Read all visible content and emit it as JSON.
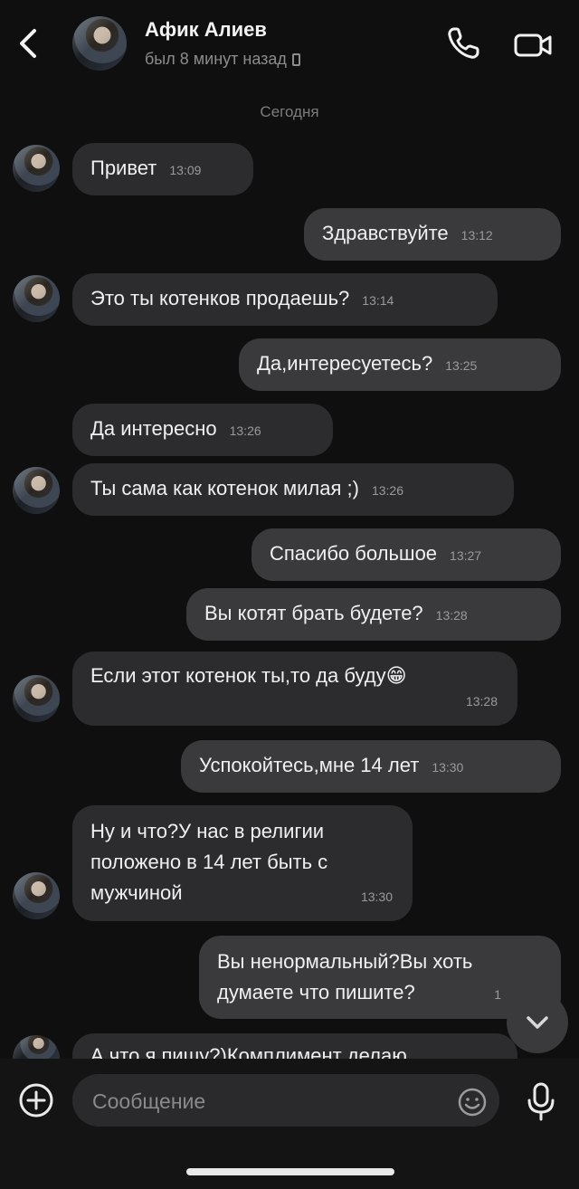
{
  "header": {
    "contact_name": "Афик Алиев",
    "status": "был 8 минут назад"
  },
  "date_separator": "Сегодня",
  "messages": [
    {
      "dir": "in",
      "text": "Привет",
      "time": "13:09"
    },
    {
      "dir": "out",
      "text": "Здравствуйте",
      "time": "13:12"
    },
    {
      "dir": "in",
      "text": "Это ты котенков продаешь?",
      "time": "13:14"
    },
    {
      "dir": "out",
      "text": "Да,интересуетесь?",
      "time": "13:25"
    },
    {
      "dir": "in",
      "text": "Да интересно",
      "time": "13:26"
    },
    {
      "dir": "in",
      "text": "Ты сама как котенок милая ;)",
      "time": "13:26"
    },
    {
      "dir": "out",
      "text": "Спасибо большое",
      "time": "13:27"
    },
    {
      "dir": "out",
      "text": "Вы котят брать будете?",
      "time": "13:28"
    },
    {
      "dir": "in",
      "text": "Если этот котенок ты,то да буду😁",
      "time": "13:28"
    },
    {
      "dir": "out",
      "text": "Успокойтесь,мне 14 лет",
      "time": "13:30"
    },
    {
      "dir": "in",
      "text": "Ну и что?У нас в религии положено в 14 лет быть с мужчиной",
      "time": "13:30"
    },
    {
      "dir": "out",
      "text": "Вы ненормальный?Вы хоть думаете что пишите?",
      "time": "1"
    },
    {
      "dir": "in",
      "text": "А что я пишу?)Комплимент делаю",
      "time": ""
    }
  ],
  "composer": {
    "placeholder": "Сообщение"
  },
  "colors": {
    "background": "#0f0f0f",
    "incoming_bubble": "#2c2c2e",
    "outgoing_bubble": "#3a3a3c"
  }
}
